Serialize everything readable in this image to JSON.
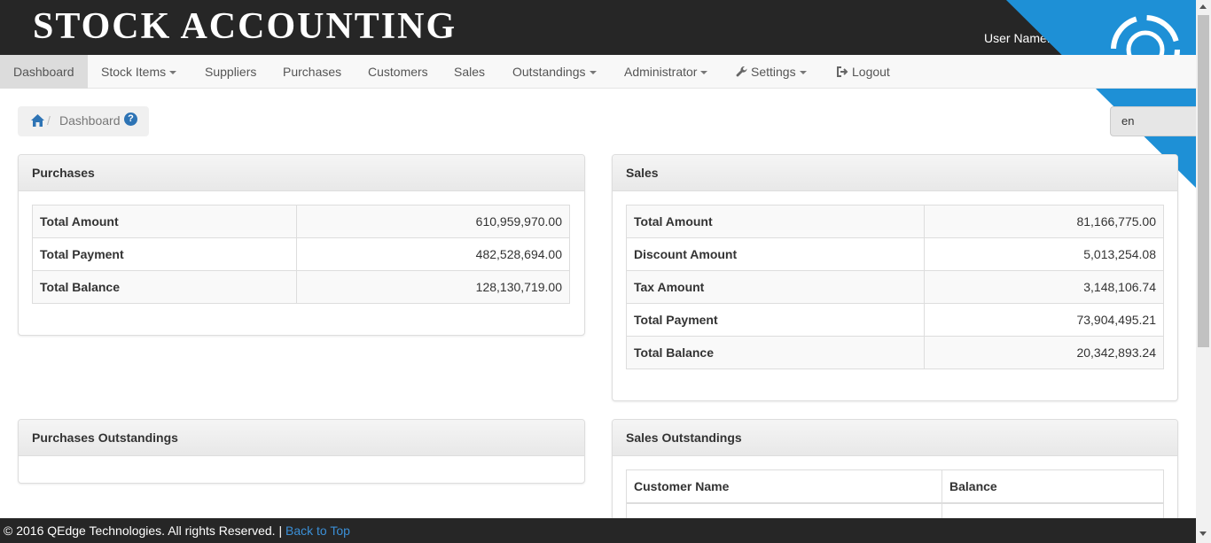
{
  "app": {
    "title": "STOCK ACCOUNTING",
    "user_label": "User Name:"
  },
  "nav": {
    "items": [
      {
        "label": "Dashboard",
        "dropdown": false
      },
      {
        "label": "Stock Items",
        "dropdown": true
      },
      {
        "label": "Suppliers",
        "dropdown": false
      },
      {
        "label": "Purchases",
        "dropdown": false
      },
      {
        "label": "Customers",
        "dropdown": false
      },
      {
        "label": "Sales",
        "dropdown": false
      },
      {
        "label": "Outstandings",
        "dropdown": true
      },
      {
        "label": "Administrator",
        "dropdown": true
      },
      {
        "label": "Settings",
        "dropdown": true,
        "icon": "wrench-icon"
      },
      {
        "label": "Logout",
        "dropdown": false,
        "icon": "logout-icon"
      }
    ],
    "active": "Dashboard"
  },
  "breadcrumb": {
    "separator": "/",
    "current": "Dashboard",
    "help": "?"
  },
  "language_button": {
    "label": "en"
  },
  "purchases": {
    "title": "Purchases",
    "rows": [
      {
        "label": "Total Amount",
        "value": "610,959,970.00"
      },
      {
        "label": "Total Payment",
        "value": "482,528,694.00"
      },
      {
        "label": "Total Balance",
        "value": "128,130,719.00"
      }
    ]
  },
  "sales": {
    "title": "Sales",
    "rows": [
      {
        "label": "Total Amount",
        "value": "81,166,775.00"
      },
      {
        "label": "Discount Amount",
        "value": "5,013,254.08"
      },
      {
        "label": "Tax Amount",
        "value": "3,148,106.74"
      },
      {
        "label": "Total Payment",
        "value": "73,904,495.21"
      },
      {
        "label": "Total Balance",
        "value": "20,342,893.24"
      }
    ]
  },
  "purchases_outstandings": {
    "title": "Purchases Outstandings"
  },
  "sales_outstandings": {
    "title": "Sales Outstandings",
    "columns": [
      "Customer Name",
      "Balance"
    ]
  },
  "footer": {
    "copyright": "© 2016 QEdge Technologies. All rights Reserved. |",
    "back_to_top": "Back to Top"
  },
  "colors": {
    "header_bg": "#262626",
    "ribbon": "#1e90d6",
    "link": "#3b8fd6"
  }
}
